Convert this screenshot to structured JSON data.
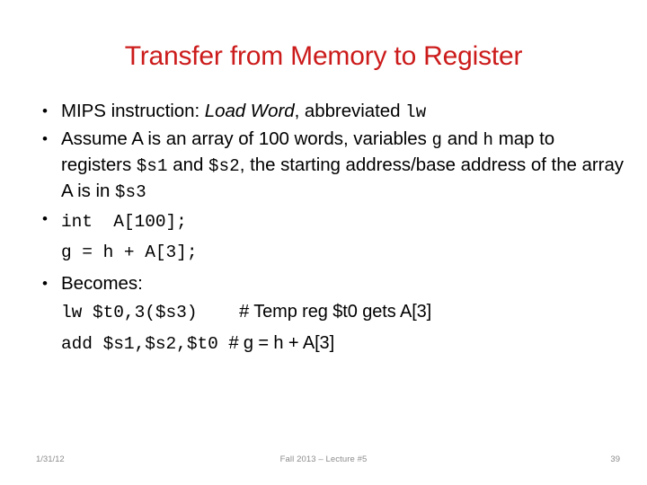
{
  "slide": {
    "title": "Transfer from Memory to Register",
    "title_color": "#CC1B1B",
    "bullets": [
      {
        "marker": "•",
        "segments": [
          {
            "text": "MIPS instruction: ",
            "style": "normal"
          },
          {
            "text": "Load Word",
            "style": "italic"
          },
          {
            "text": ", abbreviated ",
            "style": "normal"
          },
          {
            "text": "lw",
            "style": "mono"
          }
        ]
      },
      {
        "marker": "•",
        "segments": [
          {
            "text": "Assume A is an array of 100 words, variables ",
            "style": "normal"
          },
          {
            "text": "g",
            "style": "mono"
          },
          {
            "text": " and ",
            "style": "normal"
          },
          {
            "text": "h",
            "style": "mono"
          },
          {
            "text": " map to registers ",
            "style": "normal"
          },
          {
            "text": "$s1",
            "style": "mono"
          },
          {
            "text": " and ",
            "style": "normal"
          },
          {
            "text": "$s2",
            "style": "mono"
          },
          {
            "text": ", the starting address/base address of the array A is in ",
            "style": "normal"
          },
          {
            "text": "$s3",
            "style": "mono"
          }
        ]
      },
      {
        "marker": "•",
        "code_lines": [
          {
            "code": "int  A[100];",
            "comment": ""
          },
          {
            "code": "g = h + A[3];",
            "comment": ""
          }
        ]
      },
      {
        "marker": "•",
        "segments": [
          {
            "text": "Becomes:",
            "style": "normal"
          }
        ],
        "code_lines": [
          {
            "code": "lw $t0,3($s3)",
            "comment": "# Temp reg $t0 gets A[3]"
          },
          {
            "code": "add $s1,$s2,$t0",
            "comment": "# g = h + A[3]"
          }
        ]
      }
    ]
  },
  "footer": {
    "date": "1/31/12",
    "center": "Fall 2013 – Lecture #5",
    "page_number": "39"
  }
}
